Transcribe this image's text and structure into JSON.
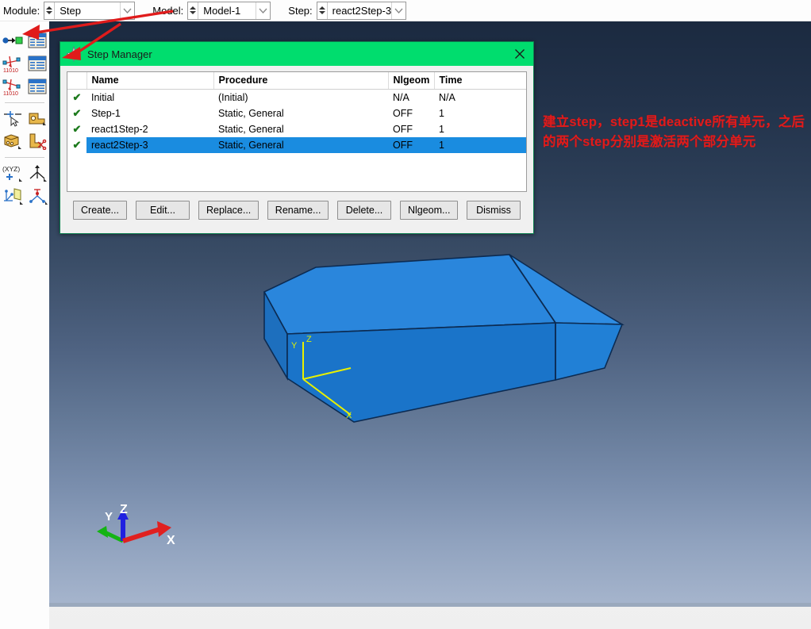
{
  "context_bar": {
    "module": {
      "label": "Module:",
      "value": "Step",
      "icon": "spinner-chevron-icon"
    },
    "model": {
      "label": "Model:",
      "value": "Model-1",
      "icon": "spinner-chevron-icon"
    },
    "step": {
      "label": "Step:",
      "value": "react2Step-3",
      "icon": "spinner-chevron-icon"
    }
  },
  "toolbox": {
    "groups": [
      {
        "icons": [
          [
            "create-step-icon",
            "step-manager-icon"
          ],
          [
            "create-field-output-request-icon",
            "field-output-manager-icon"
          ],
          [
            "create-history-output-request-icon",
            "history-output-manager-icon"
          ]
        ]
      },
      {
        "icons": [
          [
            "create-adaptive-mesh-icon",
            "create-interaction-icon"
          ],
          [
            "adaptive-mesh-constraint-icon",
            "edit-interaction-icon"
          ]
        ]
      },
      {
        "icons": [
          [
            "create-coordinate-system-icon",
            "create-datum-axis-icon"
          ],
          [
            "create-datum-plane-icon",
            "create-datum-point-icon"
          ]
        ]
      }
    ]
  },
  "step_manager": {
    "title": "Step Manager",
    "title_icon": "abaqus-dialog-star-icon",
    "close_icon": "close-icon",
    "accent_color": "#00dd6e",
    "selection_color": "#1a8ce0",
    "columns": [
      "",
      "Name",
      "Procedure",
      "Nlgeom",
      "Time"
    ],
    "rows": [
      {
        "checked": "✔",
        "name": "Initial",
        "procedure": "(Initial)",
        "nlgeom": "N/A",
        "time": "N/A",
        "selected": false
      },
      {
        "checked": "✔",
        "name": "Step-1",
        "procedure": "Static, General",
        "nlgeom": "OFF",
        "time": "1",
        "selected": false
      },
      {
        "checked": "✔",
        "name": "react1Step-2",
        "procedure": "Static, General",
        "nlgeom": "OFF",
        "time": "1",
        "selected": false
      },
      {
        "checked": "✔",
        "name": "react2Step-3",
        "procedure": "Static, General",
        "nlgeom": "OFF",
        "time": "1",
        "selected": true
      }
    ],
    "buttons": [
      {
        "label": "Create...",
        "name": "create-button"
      },
      {
        "label": "Edit...",
        "name": "edit-button"
      },
      {
        "label": "Replace...",
        "name": "replace-button"
      },
      {
        "label": "Rename...",
        "name": "rename-button"
      },
      {
        "label": "Delete...",
        "name": "delete-button"
      },
      {
        "label": "Nlgeom...",
        "name": "nlgeom-button"
      },
      {
        "label": "Dismiss",
        "name": "dismiss-button"
      }
    ]
  },
  "viewport": {
    "background_top": "#1b2a40",
    "background_bottom": "#a5b4cc",
    "part_color": "#1f7fd4",
    "origin_triad": {
      "x": "X",
      "y": "Y",
      "z": "Z",
      "color": "#e8f000"
    },
    "view_triad": {
      "x": "X",
      "y": "Y",
      "z": "Z",
      "x_color": "#e02020",
      "y_color": "#14b414",
      "z_color": "#2020e0"
    }
  },
  "annotation": {
    "text": "建立step，step1是deactive所有单元，之后的两个step分别是激活两个部分单元",
    "color": "#e01b1b"
  }
}
